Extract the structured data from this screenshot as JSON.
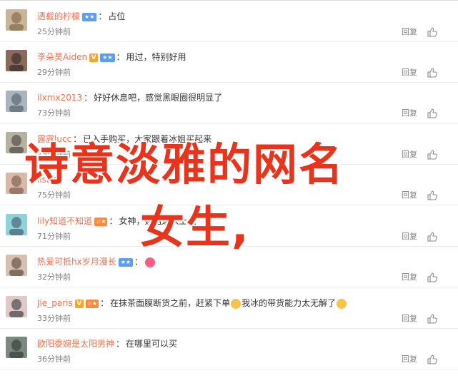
{
  "comments": [
    {
      "username": "透截的柠檬",
      "badges": [
        "vip"
      ],
      "text": "占位",
      "time": "25分钟前",
      "reply": "回复",
      "avatar_colors": [
        "#c9b59a",
        "#7a5a3a"
      ]
    },
    {
      "username": "李朵昊Aiden",
      "badges": [
        "v",
        "vip"
      ],
      "text": "用过，特别好用",
      "time": "29分钟前",
      "reply": "回复",
      "avatar_colors": [
        "#8a6a5a",
        "#2a2020"
      ]
    },
    {
      "username": "ilxmx2013",
      "badges": [],
      "text": "好好休息吧，感觉黑眼圈很明显了",
      "time": "73分钟前",
      "reply": "回复",
      "avatar_colors": [
        "#a9b4bf",
        "#4a5560"
      ]
    },
    {
      "username": "露露lucc",
      "badges": [],
      "text": "已入手购买，大家跟着冰姐买起来",
      "time": "75分钟前",
      "reply": "回复",
      "avatar_colors": [
        "#b8b0a0",
        "#3a3838"
      ]
    },
    {
      "username": "lisa",
      "badges": [],
      "text": "",
      "time": "75分钟前",
      "reply": "回复",
      "avatar_colors": [
        "#d8b8a8",
        "#705040"
      ]
    },
    {
      "username": "lily知道不知道",
      "badges": [
        "sat"
      ],
      "text": "女神，姐姐达人上线",
      "time": "71分钟前",
      "reply": "回复",
      "avatar_colors": [
        "#8fd3d8",
        "#3a4a60"
      ]
    },
    {
      "username": "热爱可抵hx岁月漫长",
      "badges": [
        "vip"
      ],
      "text": "",
      "time": "32分钟前",
      "reply": "回复",
      "avatar_colors": [
        "#d8c0b0",
        "#4a3830"
      ]
    },
    {
      "username": "Jie_paris",
      "badges": [
        "v",
        "sat"
      ],
      "text": "在抹茶面膜断货之前，赶紧下单",
      "text_tail": "我冰的带货能力太无解了",
      "time": "33分钟前",
      "reply": "回复",
      "avatar_colors": [
        "#e0c8c8",
        "#2a2a30"
      ]
    },
    {
      "username": "欧阳委婉是太阳男神",
      "badges": [],
      "text": "在哪里可以买",
      "time": "36分钟前",
      "reply": "回复",
      "avatar_colors": [
        "#7a8a80",
        "#2a302a"
      ]
    }
  ],
  "overlay": {
    "line1": "诗意淡雅的网名",
    "line2": "女生,"
  },
  "colors": {
    "username": "#eb7350",
    "overlay": "#e8341c",
    "meta": "#808080"
  }
}
